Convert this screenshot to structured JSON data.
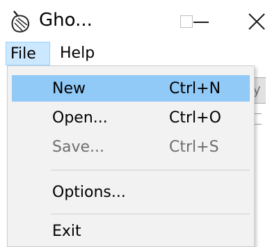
{
  "window": {
    "title": "Gho...",
    "icon": "ghost-app-icon"
  },
  "menubar": {
    "file_label": "File",
    "help_label": "Help"
  },
  "background": {
    "button_fragment": "y"
  },
  "file_menu": {
    "items": [
      {
        "label": "New",
        "shortcut": "Ctrl+N",
        "highlighted": true,
        "enabled": true
      },
      {
        "label": "Open...",
        "shortcut": "Ctrl+O",
        "highlighted": false,
        "enabled": true
      },
      {
        "label": "Save...",
        "shortcut": "Ctrl+S",
        "highlighted": false,
        "enabled": false
      },
      {
        "label": "Options...",
        "shortcut": "",
        "highlighted": false,
        "enabled": true
      },
      {
        "label": "Exit",
        "shortcut": "",
        "highlighted": false,
        "enabled": true
      }
    ]
  },
  "colors": {
    "highlight": "#91c9f7",
    "menu_open": "#cce8ff",
    "menu_background": "#f2f2f2",
    "disabled_text": "#6d6d6d"
  }
}
